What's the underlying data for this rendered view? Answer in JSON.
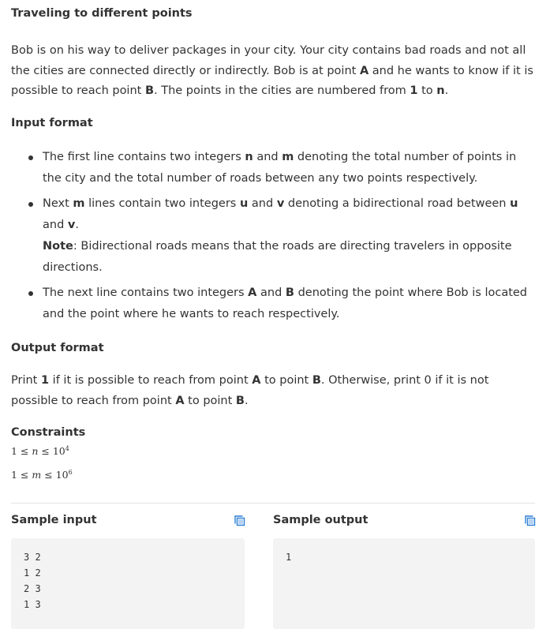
{
  "problem": {
    "title": "Traveling to different points",
    "intro": {
      "p1": "Bob is on his way to deliver packages in your city. Your city contains bad roads and not all the cities are connected directly or indirectly. Bob is at point ",
      "A": "A",
      "p2": " and he wants to know if it is possible to reach point ",
      "B": "B",
      "p3": ". The points in the cities are numbered from ",
      "one": "1",
      "p4": " to ",
      "n": "n",
      "p5": "."
    },
    "input_heading": "Input format",
    "input_items": {
      "i1": {
        "t1": "The first line contains two integers ",
        "b1": "n",
        "t2": " and ",
        "b2": "m",
        "t3": " denoting the total number of points in the city and the total number of roads between any two points respectively."
      },
      "i2": {
        "t1": "Next ",
        "b1": "m",
        "t2": " lines contain two integers ",
        "b2": "u",
        "t3": " and ",
        "b3": "v",
        "t4": " denoting a bidirectional road between ",
        "b4": "u",
        "t5": " and ",
        "b5": "v",
        "t6": ".",
        "note_label": "Note",
        "note_text": ": Bidirectional roads means that the roads are directing travelers in opposite directions."
      },
      "i3": {
        "t1": "The next line contains two integers ",
        "b1": "A",
        "t2": " and ",
        "b2": "B",
        "t3": " denoting the point where Bob is located and the point where he wants to reach respectively."
      }
    },
    "output_heading": "Output format",
    "output": {
      "t1": "Print ",
      "b1": "1",
      "t2": " if it is possible to reach from point ",
      "b2": "A",
      "t3": " to point ",
      "b3": "B",
      "t4": ". Otherwise, print 0 if it is not possible to reach from point ",
      "b4": "A",
      "t5": " to point ",
      "b5": "B",
      "t6": "."
    },
    "constraints_heading": "Constraints",
    "constraints": {
      "c1": {
        "lhs": "1 ≤ ",
        "var": "n",
        "rhs": " ≤ 10",
        "exp": "4"
      },
      "c2": {
        "lhs": "1 ≤ ",
        "var": "m",
        "rhs": " ≤ 10",
        "exp": "6"
      }
    }
  },
  "samples": {
    "input_label": "Sample input",
    "output_label": "Sample output",
    "input_text": "3 2\n1 2\n2 3\n1 3",
    "output_text": "1",
    "copy_icon": "copy-icon",
    "icon_color": "#2c7fd6"
  }
}
